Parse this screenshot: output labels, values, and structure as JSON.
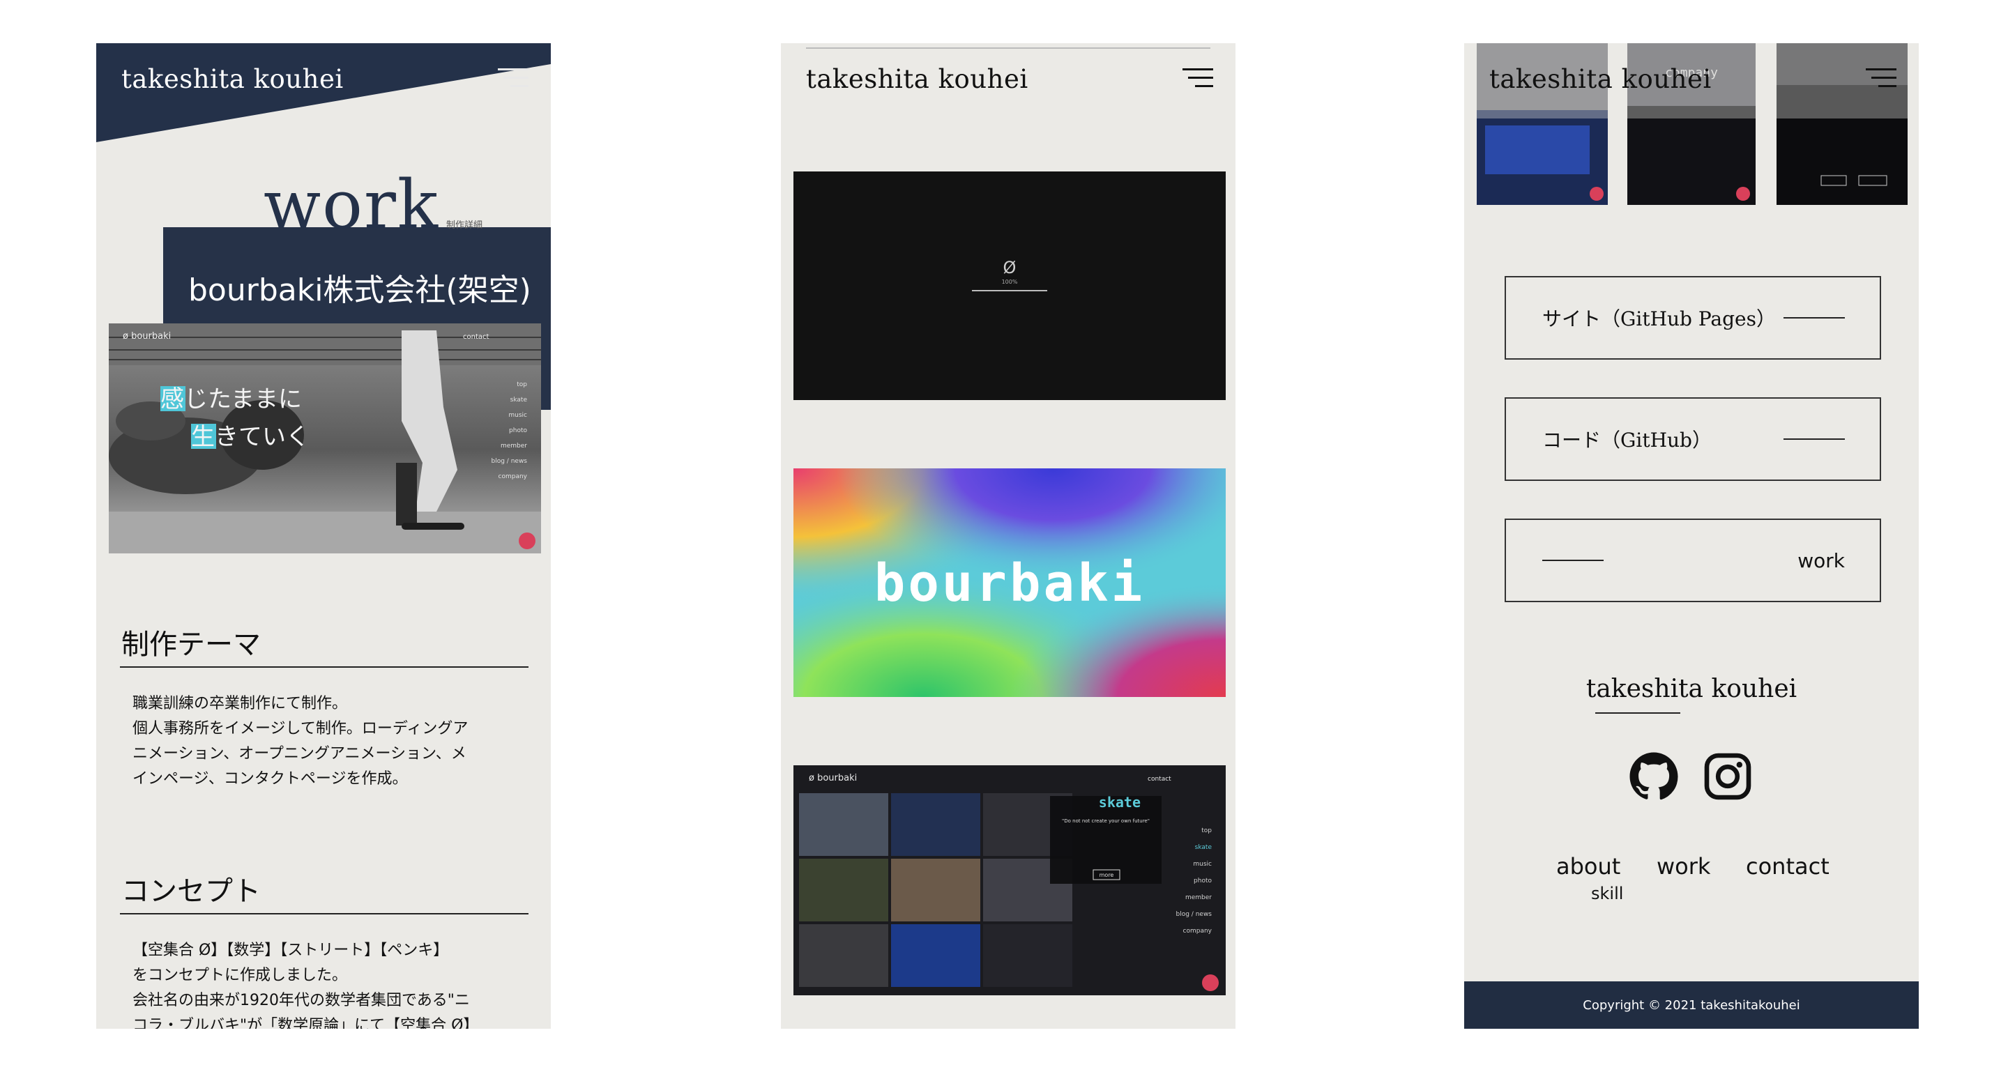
{
  "brand": "takeshita kouhei",
  "phone1": {
    "page_title": "work",
    "page_subtitle": "制作詳細",
    "company": "bourbaki株式会社(架空)",
    "hero": {
      "logo": "ø bourbaki",
      "nav_contact": "contact",
      "tagline_1": "感じたままに",
      "tagline_2": "生きていく",
      "menu": [
        "top",
        "skate",
        "music",
        "photo",
        "member",
        "blog / news",
        "company"
      ]
    },
    "theme_heading": "制作テーマ",
    "theme_lines": [
      "職業訓練の卒業制作にて制作。",
      "個人事務所をイメージして制作。ローディングア",
      "ニメーション、オープニングアニメーション、メ",
      "インページ、コンタクトページを作成。"
    ],
    "concept_heading": "コンセプト",
    "concept_lines": [
      "【空集合 Ø】【数学】【ストリート】【ペンキ】",
      "をコンセプトに作成しました。",
      "会社名の由来が1920年代の数学者集団である\"ニ",
      "コラ・ブルバキ\"が「数学原論」にて【空集合 Ø】"
    ]
  },
  "phone2": {
    "loader_symbol": "Ø",
    "loader_percent": "100%",
    "splash_word": "bourbaki",
    "gallery": {
      "logo": "ø bourbaki",
      "nav_contact": "contact",
      "section": "skate",
      "quote": "\"Do not not create your own future\"",
      "more": "more",
      "menu": [
        "top",
        "skate",
        "music",
        "photo",
        "member",
        "blog / news",
        "company"
      ]
    }
  },
  "phone3": {
    "shot_label": "company",
    "links": [
      {
        "label": "サイト（GitHub Pages）"
      },
      {
        "label": "コード（GitHub）"
      },
      {
        "label": "work"
      }
    ],
    "footer_brand": "takeshita kouhei",
    "footer_nav": {
      "about": "about",
      "skill": "skill",
      "work": "work",
      "contact": "contact"
    },
    "copyright": "Copyright © 2021 takeshitakouhei",
    "icons": [
      "github-icon",
      "instagram-icon"
    ]
  },
  "colors": {
    "navy": "#263248",
    "paper": "#ebeae6",
    "cyan": "#5ccbd9"
  }
}
